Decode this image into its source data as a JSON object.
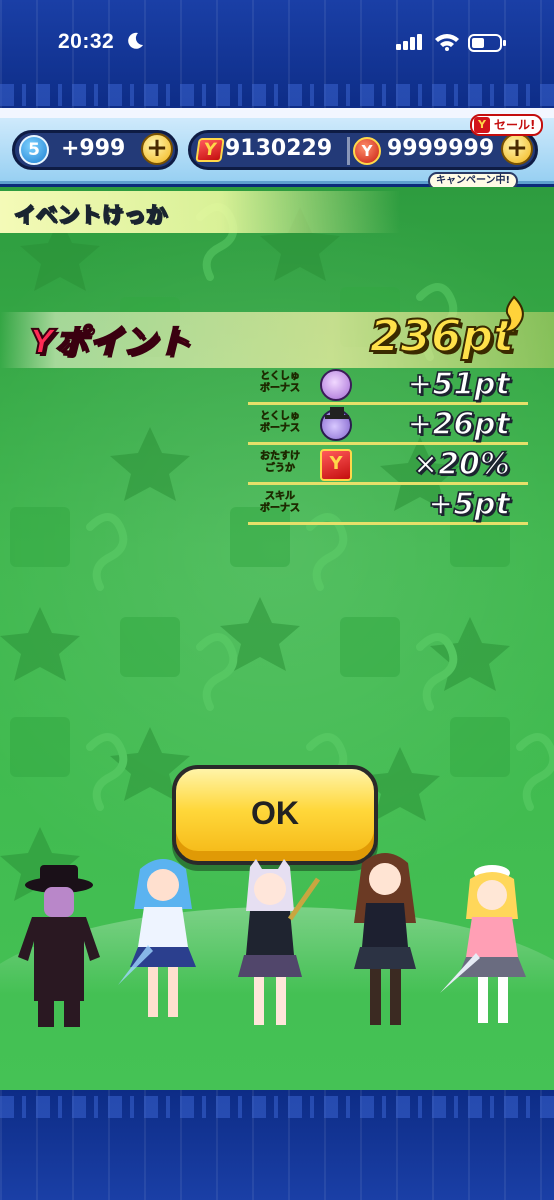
{
  "status_bar": {
    "time": "20:32",
    "icons": [
      "moon-icon",
      "signal-icon",
      "wifi-icon",
      "battery-icon"
    ]
  },
  "header": {
    "stamina_level": "5",
    "stamina_value": "+999",
    "ymoney_value": "9130229",
    "ycoin_value": "9999999",
    "sale_tag": "セール!",
    "campaign_label": "キャンペーン中!",
    "plus_label": "+"
  },
  "result": {
    "title": "イベントけっか",
    "ypoint_label": "Yポイント",
    "ypoint_total": "236pt",
    "bonuses": [
      {
        "label_line1": "とくしゅ",
        "label_line2": "ボーナス",
        "icon": "purple-cat-yokai-icon",
        "value": "+51pt"
      },
      {
        "label_line1": "とくしゅ",
        "label_line2": "ボーナス",
        "icon": "purple-hat-yokai-icon",
        "value": "+26pt"
      },
      {
        "label_line1": "おたすけ",
        "label_line2": "ごうか",
        "icon": "ymoney-ticket-icon",
        "value": "×20%"
      },
      {
        "label_line1": "スキル",
        "label_line2": "ボーナス",
        "icon": "",
        "value": "+5pt"
      }
    ],
    "ok_label": "OK"
  },
  "colors": {
    "stage_green": "#3db64c",
    "ypoint_red": "#ff2b55",
    "total_yellow": "#ffe14a",
    "ok_yellow": "#ffd73a",
    "frame_blue": "#0d2c86"
  },
  "characters": [
    "masked-man-in-hat",
    "blue-haired-idol",
    "cat-eared-idol",
    "brown-haired-idol",
    "blonde-maid-idol"
  ]
}
